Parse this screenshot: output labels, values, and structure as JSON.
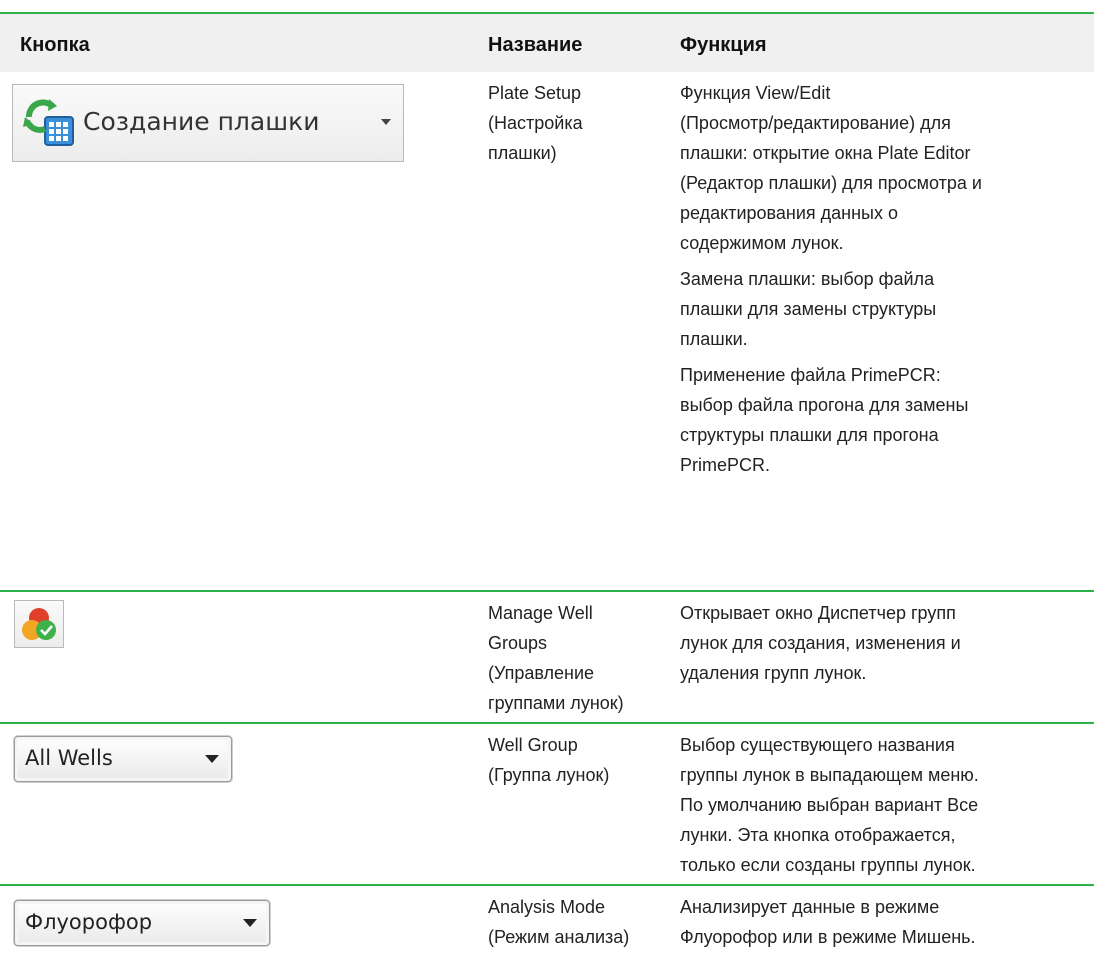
{
  "header": {
    "col_button": "Кнопка",
    "col_name": "Название",
    "col_function": "Функция"
  },
  "rows": [
    {
      "button": {
        "label": "Создание плашки",
        "icon": "plate-setup-icon"
      },
      "name_lines": [
        "Plate Setup",
        "(Настройка",
        "плашки)"
      ],
      "function_paragraphs": [
        [
          "Функция View/Edit",
          "(Просмотр/редактирование) для",
          "плашки: открытие окна Plate Editor",
          "(Редактор плашки) для просмотра и",
          "редактирования данных о",
          "содержимом лунок."
        ],
        [
          "Замена плашки: выбор файла",
          "плашки для замены структуры",
          "плашки."
        ],
        [
          "Применение файла PrimePCR:",
          "выбор файла прогона для замены",
          "структуры плашки для прогона",
          "PrimePCR."
        ]
      ]
    },
    {
      "button": {
        "label": "",
        "icon": "well-groups-icon"
      },
      "name_lines": [
        "Manage Well",
        "Groups",
        "(Управление",
        "группами лунок)"
      ],
      "function_paragraphs": [
        [
          "Открывает окно Диспетчер групп",
          "лунок для создания, изменения и",
          "удаления групп лунок."
        ]
      ]
    },
    {
      "button": {
        "label": "All Wells",
        "icon": "dropdown-arrow-icon"
      },
      "name_lines": [
        "Well Group",
        "(Группа лунок)"
      ],
      "function_paragraphs": [
        [
          "Выбор существующего названия",
          "группы лунок в выпадающем меню.",
          "По умолчанию выбран вариант Все",
          "лунки. Эта кнопка отображается,",
          "только если созданы группы лунок."
        ]
      ]
    },
    {
      "button": {
        "label": "Флуорофор",
        "icon": "dropdown-arrow-icon"
      },
      "name_lines": [
        "Analysis Mode",
        "(Режим анализа)"
      ],
      "function_paragraphs": [
        [
          "Анализирует данные в режиме",
          "Флуорофор или в режиме Мишень."
        ]
      ]
    }
  ],
  "colors": {
    "rule": "#2bb24c",
    "header_bg": "#f0f0f0"
  }
}
